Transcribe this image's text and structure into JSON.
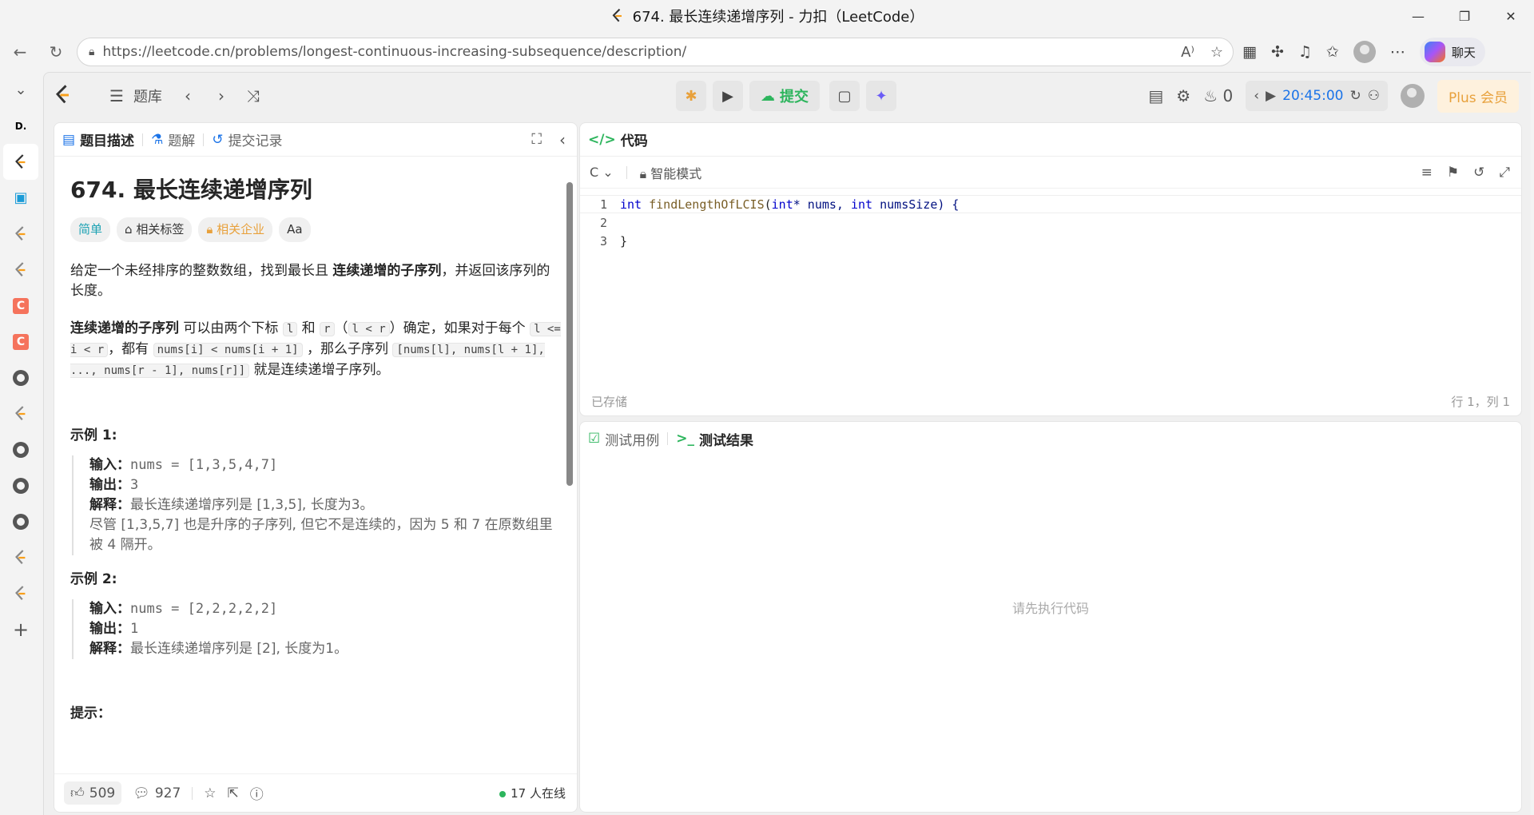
{
  "window": {
    "title": "674. 最长连续递增序列 - 力扣（LeetCode）"
  },
  "browser": {
    "url": "https://leetcode.cn/problems/longest-continuous-increasing-subsequence/description/",
    "chat_label": "聊天"
  },
  "nav": {
    "problem_bank": "题库"
  },
  "toolbar": {
    "submit": "提交",
    "streak": "0",
    "timer": "20:45:00",
    "plus": "Plus 会员"
  },
  "left_tabs": {
    "description": "题目描述",
    "solution": "题解",
    "submissions": "提交记录"
  },
  "problem": {
    "title": "674. 最长连续递增序列",
    "tags": {
      "difficulty": "简单",
      "topics": "相关标签",
      "companies": "相关企业",
      "font": "Aa"
    },
    "p1_a": "给定一个未经排序的整数数组，找到最长且 ",
    "p1_b": "连续递增的子序列",
    "p1_c": "，并返回该序列的长度。",
    "p2_a": "连续递增的子序列",
    "p2_b": " 可以由两个下标 ",
    "c_l": "l",
    "p2_c": " 和 ",
    "c_r": "r",
    "p2_d": "（",
    "c_lr": "l < r",
    "p2_e": "）确定，如果对于每个 ",
    "c_range": "l <= i < r",
    "p2_f": "，都有 ",
    "c_cmp": "nums[i] < nums[i + 1]",
    "p2_g": " ，那么子序列 ",
    "c_seq": "[nums[l], nums[l + 1], ..., nums[r - 1], nums[r]]",
    "p2_h": " 就是连续递增子序列。",
    "example1_title": "示例 1:",
    "ex1": {
      "in_label": "输入：",
      "in": "nums = [1,3,5,4,7]",
      "out_label": "输出：",
      "out": "3",
      "exp_label": "解释：",
      "exp": "最长连续递增序列是 [1,3,5], 长度为3。",
      "exp2": "尽管 [1,3,5,7] 也是升序的子序列, 但它不是连续的，因为 5 和 7 在原数组里被 4 隔开。"
    },
    "example2_title": "示例 2:",
    "ex2": {
      "in_label": "输入：",
      "in": "nums = [2,2,2,2,2]",
      "out_label": "输出：",
      "out": "1",
      "exp_label": "解释：",
      "exp": "最长连续递增序列是 [2], 长度为1。"
    },
    "hints_title": "提示："
  },
  "footer": {
    "likes": "509",
    "comments": "927",
    "online": "17 人在线"
  },
  "code_panel": {
    "title": "代码",
    "lang": "C",
    "mode": "智能模式",
    "saved": "已存储",
    "cursor": "行 1，列 1",
    "lines": [
      {
        "n": "1"
      },
      {
        "n": "2"
      },
      {
        "n": "3",
        "text": "}"
      }
    ],
    "sig": {
      "int1": "int",
      "fn": "findLengthOfLCIS",
      "p1": "(",
      "int2": "int",
      "p2": "* nums, ",
      "int3": "int",
      "p3": " numsSize) {"
    }
  },
  "test_panel": {
    "cases": "测试用例",
    "result": "测试结果",
    "placeholder": "请先执行代码"
  }
}
